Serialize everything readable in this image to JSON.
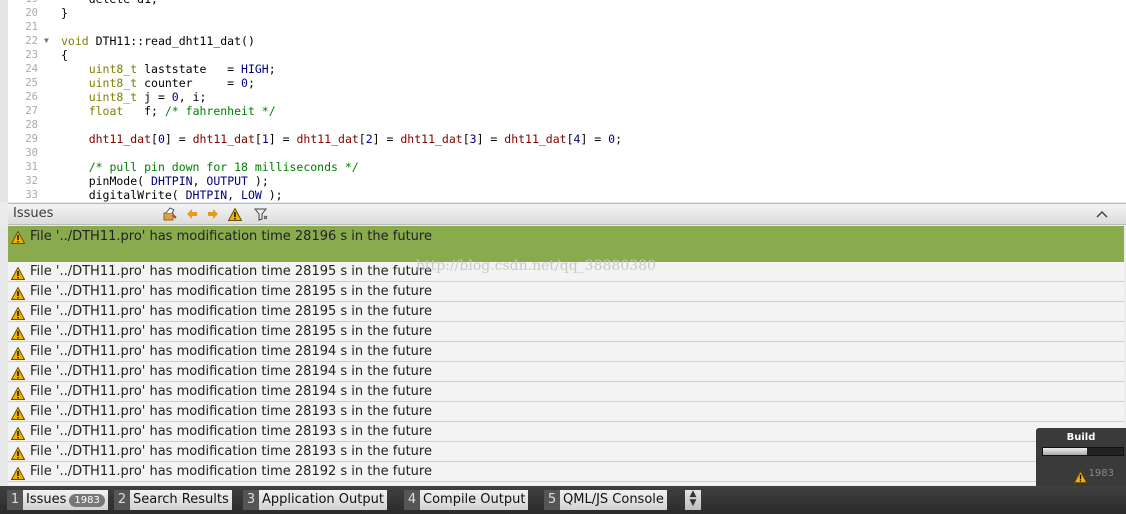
{
  "editor": {
    "lines": [
      {
        "n": "19",
        "parts": [
          {
            "t": "    delete d1;"
          }
        ]
      },
      {
        "n": "20",
        "parts": [
          {
            "t": "}"
          }
        ]
      },
      {
        "n": "21",
        "parts": []
      },
      {
        "n": "22",
        "fold": true,
        "parts": [
          {
            "t": "void",
            "k": "kw"
          },
          {
            "t": " DTH11::read_dht11_dat()"
          }
        ]
      },
      {
        "n": "23",
        "parts": [
          {
            "t": "{"
          }
        ]
      },
      {
        "n": "24",
        "parts": [
          {
            "t": "    "
          },
          {
            "t": "uint8_t",
            "k": "t"
          },
          {
            "t": " laststate   = "
          },
          {
            "t": "HIGH",
            "k": "m"
          },
          {
            "t": ";"
          }
        ]
      },
      {
        "n": "25",
        "parts": [
          {
            "t": "    "
          },
          {
            "t": "uint8_t",
            "k": "t"
          },
          {
            "t": " counter     = "
          },
          {
            "t": "0",
            "k": "n"
          },
          {
            "t": ";"
          }
        ]
      },
      {
        "n": "26",
        "parts": [
          {
            "t": "    "
          },
          {
            "t": "uint8_t",
            "k": "t"
          },
          {
            "t": " j = "
          },
          {
            "t": "0",
            "k": "n"
          },
          {
            "t": ", i;"
          }
        ]
      },
      {
        "n": "27",
        "parts": [
          {
            "t": "    "
          },
          {
            "t": "float",
            "k": "kw"
          },
          {
            "t": "   f; "
          },
          {
            "t": "/* fahrenheit */",
            "k": "c"
          }
        ]
      },
      {
        "n": "28",
        "parts": []
      },
      {
        "n": "29",
        "parts": [
          {
            "t": "    "
          },
          {
            "t": "dht11_dat",
            "k": "v"
          },
          {
            "t": "["
          },
          {
            "t": "0",
            "k": "n"
          },
          {
            "t": "] = "
          },
          {
            "t": "dht11_dat",
            "k": "v"
          },
          {
            "t": "["
          },
          {
            "t": "1",
            "k": "n"
          },
          {
            "t": "] = "
          },
          {
            "t": "dht11_dat",
            "k": "v"
          },
          {
            "t": "["
          },
          {
            "t": "2",
            "k": "n"
          },
          {
            "t": "] = "
          },
          {
            "t": "dht11_dat",
            "k": "v"
          },
          {
            "t": "["
          },
          {
            "t": "3",
            "k": "n"
          },
          {
            "t": "] = "
          },
          {
            "t": "dht11_dat",
            "k": "v"
          },
          {
            "t": "["
          },
          {
            "t": "4",
            "k": "n"
          },
          {
            "t": "] = "
          },
          {
            "t": "0",
            "k": "n"
          },
          {
            "t": ";"
          }
        ]
      },
      {
        "n": "30",
        "parts": []
      },
      {
        "n": "31",
        "parts": [
          {
            "t": "    "
          },
          {
            "t": "/* pull pin down for 18 milliseconds */",
            "k": "c"
          }
        ]
      },
      {
        "n": "32",
        "parts": [
          {
            "t": "    pinMode( "
          },
          {
            "t": "DHTPIN",
            "k": "m"
          },
          {
            "t": ", "
          },
          {
            "t": "OUTPUT",
            "k": "m"
          },
          {
            "t": " );"
          }
        ]
      },
      {
        "n": "33",
        "parts": [
          {
            "t": "    digitalWrite( "
          },
          {
            "t": "DHTPIN",
            "k": "m"
          },
          {
            "t": ", "
          },
          {
            "t": "LOW",
            "k": "m"
          },
          {
            "t": " );"
          }
        ]
      }
    ]
  },
  "issues_panel": {
    "title": "Issues",
    "items": [
      "File '../DTH11.pro' has modification time 28196 s in the future",
      "File '../DTH11.pro' has modification time 28195 s in the future",
      "File '../DTH11.pro' has modification time 28195 s in the future",
      "File '../DTH11.pro' has modification time 28195 s in the future",
      "File '../DTH11.pro' has modification time 28195 s in the future",
      "File '../DTH11.pro' has modification time 28194 s in the future",
      "File '../DTH11.pro' has modification time 28194 s in the future",
      "File '../DTH11.pro' has modification time 28194 s in the future",
      "File '../DTH11.pro' has modification time 28193 s in the future",
      "File '../DTH11.pro' has modification time 28193 s in the future",
      "File '../DTH11.pro' has modification time 28193 s in the future",
      "File '../DTH11.pro' has modification time 28192 s in the future"
    ],
    "selected_index": 0
  },
  "watermark": "http://blog.csdn.net/qq_38880380",
  "build": {
    "label": "Build",
    "progress": 0.55,
    "warning_count": "1983"
  },
  "bottom_tabs": [
    {
      "num": "1",
      "label": "Issues",
      "badge": "1983"
    },
    {
      "num": "2",
      "label": "Search Results"
    },
    {
      "num": "3",
      "label": "Application Output"
    },
    {
      "num": "4",
      "label": "Compile Output"
    },
    {
      "num": "5",
      "label": "QML/JS Console"
    }
  ],
  "colors": {
    "selected_row": "#8aaa4e",
    "warning_fill": "#f0b400"
  },
  "icons": [
    "warning-icon",
    "filter-icon",
    "prev-arrow-icon",
    "next-arrow-icon",
    "clear-icon",
    "collapse-icon",
    "updown-arrows-icon"
  ]
}
